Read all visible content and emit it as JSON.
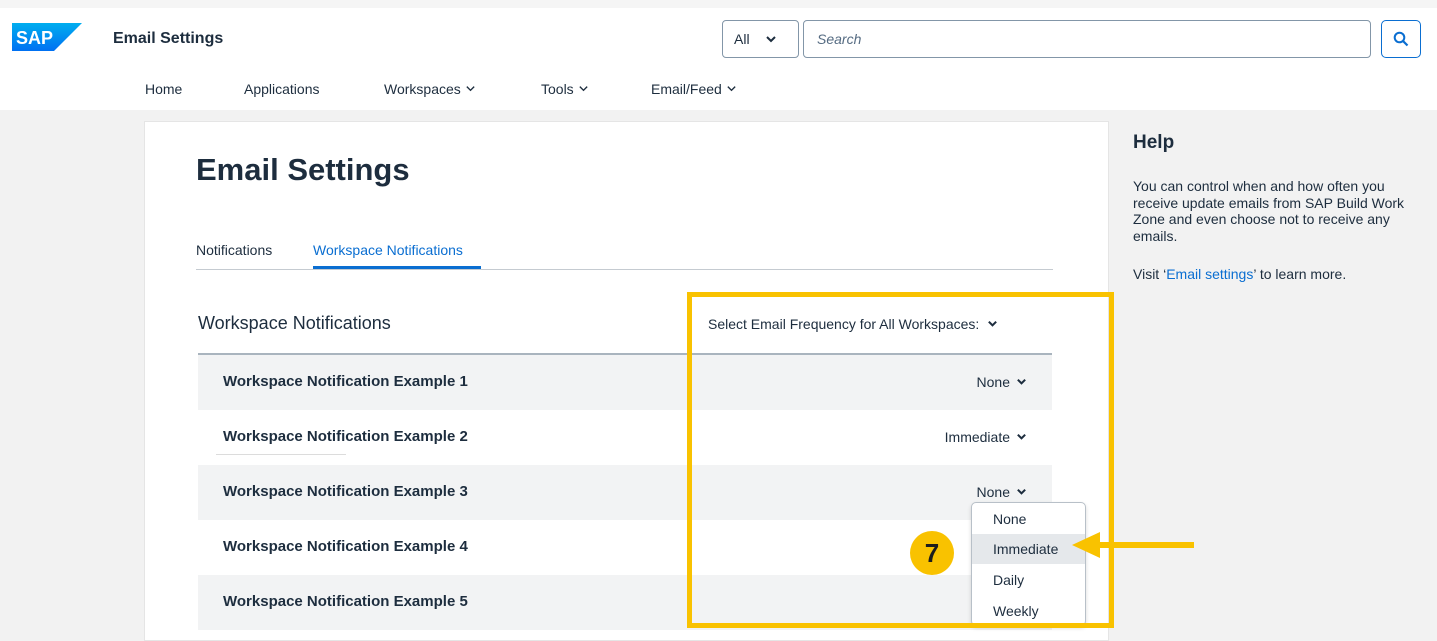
{
  "header": {
    "logo_text": "SAP",
    "title": "Email Settings",
    "scope_value": "All",
    "search_placeholder": "Search"
  },
  "nav": [
    {
      "label": "Home"
    },
    {
      "label": "Applications"
    },
    {
      "label": "Workspaces"
    },
    {
      "label": "Tools"
    },
    {
      "label": "Email/Feed"
    }
  ],
  "page": {
    "title": "Email Settings",
    "tabs": [
      {
        "label": "Notifications",
        "active": false
      },
      {
        "label": "Workspace Notifications",
        "active": true
      }
    ]
  },
  "section": {
    "title": "Workspace Notifications",
    "all_frequency_label": "Select Email Frequency for All Workspaces:",
    "rows": [
      {
        "name": "Workspace Notification Example 1",
        "frequency": "None"
      },
      {
        "name": "Workspace Notification Example 2",
        "frequency": "Immediate"
      },
      {
        "name": "Workspace Notification Example 3",
        "frequency": "None"
      },
      {
        "name": "Workspace Notification Example 4",
        "frequency": ""
      },
      {
        "name": "Workspace Notification Example 5",
        "frequency": ""
      }
    ]
  },
  "dropdown": {
    "options": [
      "None",
      "Immediate",
      "Daily",
      "Weekly"
    ],
    "highlighted": "Immediate"
  },
  "annotation": {
    "step_number": "7",
    "color": "#f9c200"
  },
  "help": {
    "title": "Help",
    "body": "You can control when and how often you receive update emails from SAP Build Work Zone and even choose not to receive any emails.",
    "link_prefix": "Visit ‘",
    "link_text": "Email settings",
    "link_suffix": "’ to learn more."
  },
  "colors": {
    "accent": "#0a6ed1",
    "brand_blue": "#0070f2",
    "text": "#1d2d3e",
    "highlight": "#f9c200"
  }
}
